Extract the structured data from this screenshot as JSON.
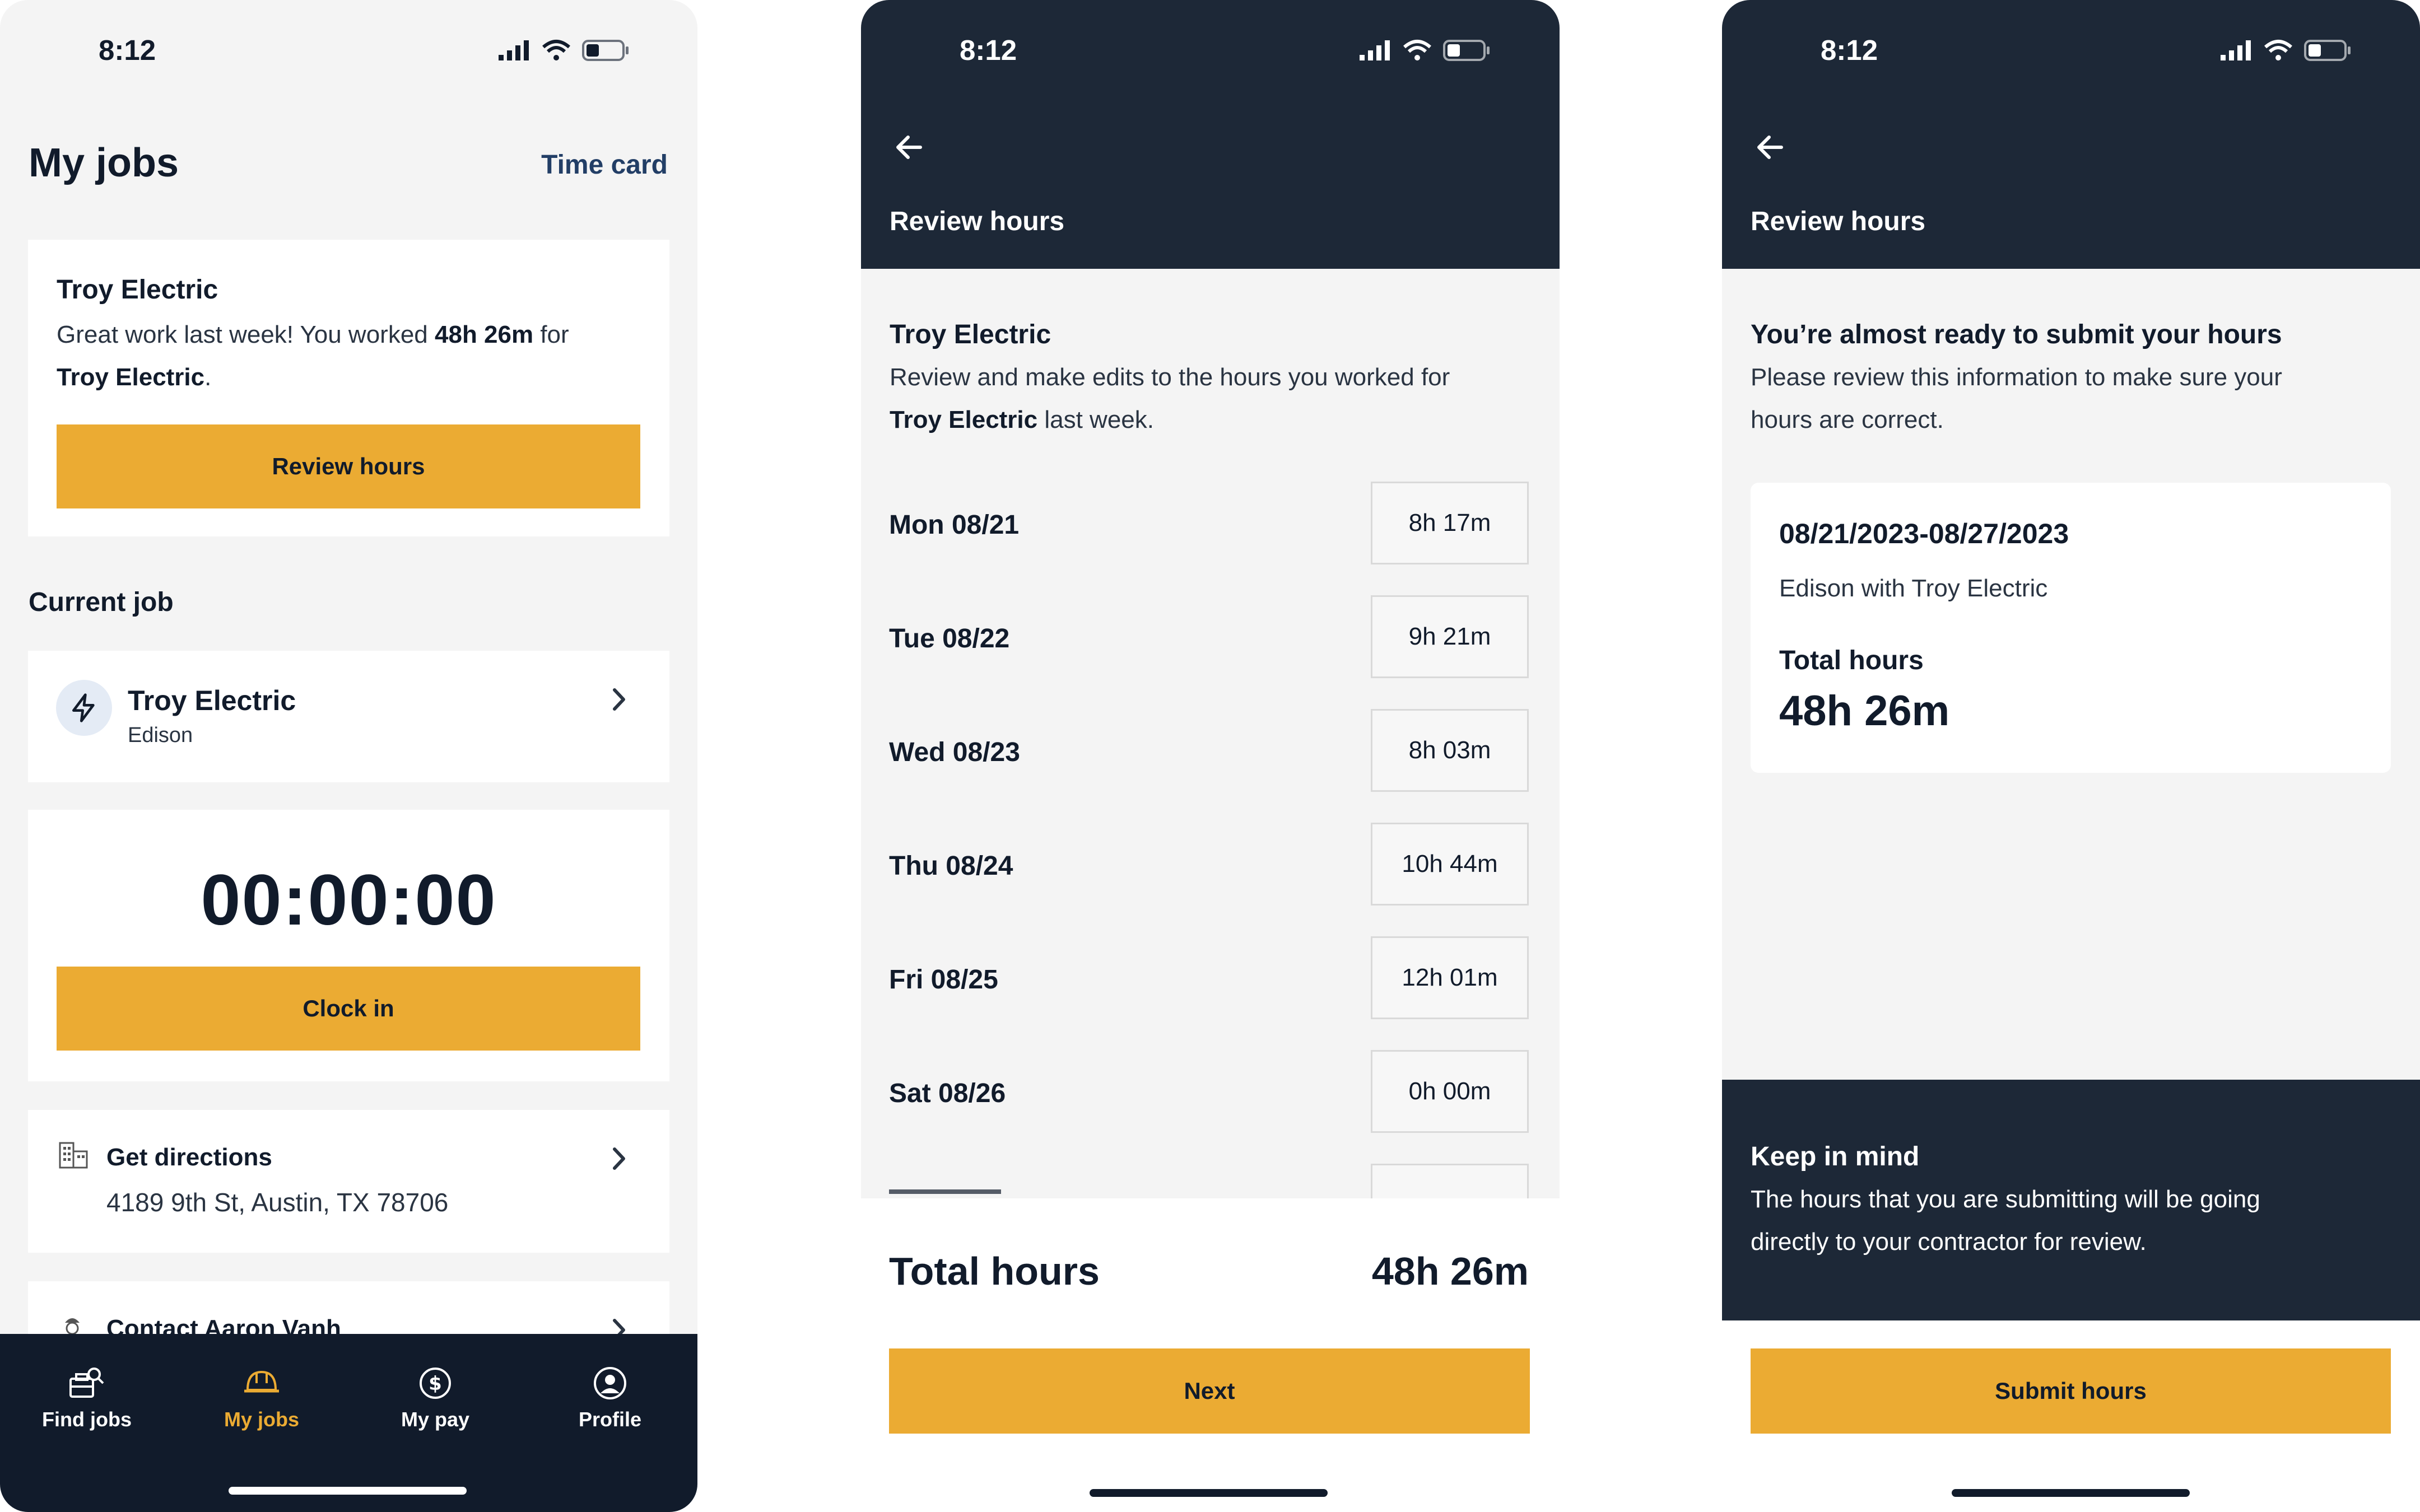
{
  "status_bar": {
    "time": "8:12"
  },
  "screen1": {
    "title": "My jobs",
    "time_card_link": "Time card",
    "summary_card": {
      "company": "Troy Electric",
      "message_pre": "Great work last week! You worked ",
      "message_hours": "48h 26m",
      "message_mid": " for",
      "message_company": "Troy Electric",
      "message_end": ".",
      "button": "Review hours"
    },
    "current_job_heading": "Current job",
    "job": {
      "company": "Troy Electric",
      "subtitle": "Edison",
      "icon": "lightning-icon"
    },
    "timer": {
      "value": "00:00:00",
      "button": "Clock in"
    },
    "directions": {
      "label": "Get directions",
      "address": "4189 9th St, Austin, TX 78706",
      "icon": "building-icon"
    },
    "contact": {
      "label": "Contact Aaron Vanh",
      "icon": "worker-icon"
    },
    "nav": [
      {
        "label": "Find jobs",
        "icon": "briefcase-search-icon",
        "active": false
      },
      {
        "label": "My jobs",
        "icon": "hard-hat-icon",
        "active": true
      },
      {
        "label": "My pay",
        "icon": "dollar-circle-icon",
        "active": false
      },
      {
        "label": "Profile",
        "icon": "profile-icon",
        "active": false
      }
    ],
    "colors": {
      "accent": "#ebab33",
      "nav_bg": "#111b2b",
      "link": "#223e66"
    }
  },
  "screen2": {
    "header_title": "Review hours",
    "company": "Troy Electric",
    "desc_pre": "Review and make edits to the hours you worked for",
    "desc_company": "Troy Electric",
    "desc_end": " last week.",
    "days": [
      {
        "label": "Mon 08/21",
        "hours": "8h 17m"
      },
      {
        "label": "Tue 08/22",
        "hours": "9h 21m"
      },
      {
        "label": "Wed 08/23",
        "hours": "8h 03m"
      },
      {
        "label": "Thu 08/24",
        "hours": "10h 44m"
      },
      {
        "label": "Fri 08/25",
        "hours": "12h 01m"
      },
      {
        "label": "Sat 08/26",
        "hours": "0h 00m"
      }
    ],
    "total_label": "Total hours",
    "total_value": "48h 26m",
    "button": "Next"
  },
  "screen3": {
    "header_title": "Review hours",
    "heading": "You’re almost ready to submit your hours",
    "desc_line1": "Please review this information to make sure your",
    "desc_line2": "hours are correct.",
    "summary": {
      "date_range": "08/21/2023-08/27/2023",
      "job": "Edison with Troy Electric",
      "total_label": "Total hours",
      "total_value": "48h 26m"
    },
    "note": {
      "title": "Keep in mind",
      "line1": "The hours that you are submitting will be going",
      "line2": "directly to your contractor for review."
    },
    "button": "Submit hours"
  }
}
